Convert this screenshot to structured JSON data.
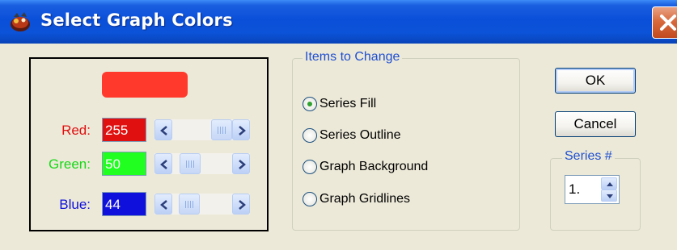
{
  "window": {
    "title": "Select Graph Colors"
  },
  "colors": {
    "swatch": "#ff3a2c",
    "red_bg": "#e01010",
    "green_bg": "#20ff20",
    "blue_bg": "#1010dd",
    "red_label": "#e01010",
    "green_label": "#18d818",
    "blue_label": "#1010dd"
  },
  "rgb": {
    "red": {
      "label": "Red:",
      "value": "255",
      "level": 1.0
    },
    "green": {
      "label": "Green:",
      "value": "50",
      "level": 0.196
    },
    "blue": {
      "label": "Blue:",
      "value": "44",
      "level": 0.173
    }
  },
  "items_group": {
    "title": "Items to Change",
    "options": [
      {
        "label": "Series Fill",
        "selected": true
      },
      {
        "label": "Series Outline",
        "selected": false
      },
      {
        "label": "Graph Background",
        "selected": false
      },
      {
        "label": "Graph Gridlines",
        "selected": false
      }
    ]
  },
  "buttons": {
    "ok": "OK",
    "cancel": "Cancel"
  },
  "series": {
    "title": "Series #",
    "value": "1."
  },
  "icons": [
    "app-icon",
    "close-icon",
    "chevron-left-icon",
    "chevron-right-icon",
    "spin-up-icon",
    "spin-down-icon"
  ]
}
